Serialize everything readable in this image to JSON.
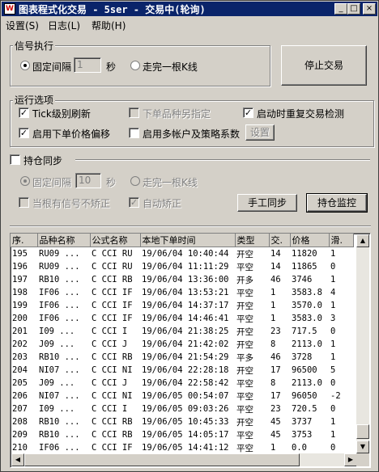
{
  "window": {
    "title": "图表程式化交易 - 5ser - 交易中(轮询)",
    "icon_glyph": "W",
    "controls": {
      "minimize": "_",
      "maximize": "□",
      "close": "×"
    }
  },
  "menu": [
    "设置(S)",
    "日志(L)",
    "帮助(H)"
  ],
  "signal_group": {
    "title": "信号执行",
    "fixed_interval_label": "固定间隔",
    "interval_value": "1",
    "seconds_label": "秒",
    "bar_complete_label": "走完一根K线",
    "selected": "fixed_interval"
  },
  "stop_trading_button": "停止交易",
  "run_options": {
    "title": "运行选项",
    "tick_refresh": {
      "label": "Tick级别刷新",
      "checked": true
    },
    "alt_product": {
      "label": "下单品种另指定",
      "checked": false,
      "disabled": true
    },
    "restart_check": {
      "label": "启动时重复交易检测",
      "checked": true
    },
    "price_offset": {
      "label": "启用下单价格偏移",
      "checked": true
    },
    "multi_account": {
      "label": "启用多帐户及策略系数",
      "checked": false
    },
    "settings_button": "设置"
  },
  "position_sync": {
    "title": "持仓同步",
    "checked": false,
    "fixed_interval_label": "固定间隔",
    "interval_value": "10",
    "seconds_label": "秒",
    "bar_complete_label": "走完一根K线",
    "no_correct_label": "当根有信号不矫正",
    "auto_correct_label": "自动矫正",
    "manual_sync_button": "手工同步",
    "monitor_button": "持仓监控"
  },
  "table": {
    "columns": [
      "序.",
      "品种名称",
      "公式名称",
      "本地下单时间",
      "类型",
      "交.",
      "价格",
      "滑."
    ],
    "rows": [
      [
        "195",
        "RU09 ...",
        "C CCI RU",
        "19/06/04 10:40:44",
        "开空",
        "14",
        "11820",
        "1"
      ],
      [
        "196",
        "RU09 ...",
        "C CCI RU",
        "19/06/04 11:11:29",
        "平空",
        "14",
        "11865",
        "0"
      ],
      [
        "197",
        "RB10 ...",
        "C CCI RB",
        "19/06/04 13:36:00",
        "开多",
        "46",
        "3746",
        "1"
      ],
      [
        "198",
        "IF06 ...",
        "C CCI IF",
        "19/06/04 13:53:21",
        "平空",
        "1",
        "3583.8",
        "4"
      ],
      [
        "199",
        "IF06 ...",
        "C CCI IF",
        "19/06/04 14:37:17",
        "开空",
        "1",
        "3570.0",
        "1"
      ],
      [
        "200",
        "IF06 ...",
        "C CCI IF",
        "19/06/04 14:46:41",
        "平空",
        "1",
        "3583.0",
        "3"
      ],
      [
        "201",
        "I09 ...",
        "C CCI I",
        "19/06/04 21:38:25",
        "开空",
        "23",
        "717.5",
        "0"
      ],
      [
        "202",
        "J09 ...",
        "C CCI J",
        "19/06/04 21:42:02",
        "开空",
        "8",
        "2113.0",
        "1"
      ],
      [
        "203",
        "RB10 ...",
        "C CCI RB",
        "19/06/04 21:54:29",
        "平多",
        "46",
        "3728",
        "1"
      ],
      [
        "204",
        "NI07 ...",
        "C CCI NI",
        "19/06/04 22:28:18",
        "开空",
        "17",
        "96500",
        "5"
      ],
      [
        "205",
        "J09 ...",
        "C CCI J",
        "19/06/04 22:58:42",
        "平空",
        "8",
        "2113.0",
        "0"
      ],
      [
        "206",
        "NI07 ...",
        "C CCI NI",
        "19/06/05 00:54:07",
        "平空",
        "17",
        "96050",
        "-2"
      ],
      [
        "207",
        "I09 ...",
        "C CCI I",
        "19/06/05 09:03:26",
        "平空",
        "23",
        "720.5",
        "0"
      ],
      [
        "208",
        "RB10 ...",
        "C CCI RB",
        "19/06/05 10:45:33",
        "开空",
        "45",
        "3737",
        "1"
      ],
      [
        "209",
        "RB10 ...",
        "C CCI RB",
        "19/06/05 14:05:17",
        "平空",
        "45",
        "3753",
        "1"
      ],
      [
        "210",
        "IF06 ...",
        "C CCI IF",
        "19/06/05 14:41:12",
        "平空",
        "1",
        "0.0",
        "0"
      ]
    ]
  }
}
